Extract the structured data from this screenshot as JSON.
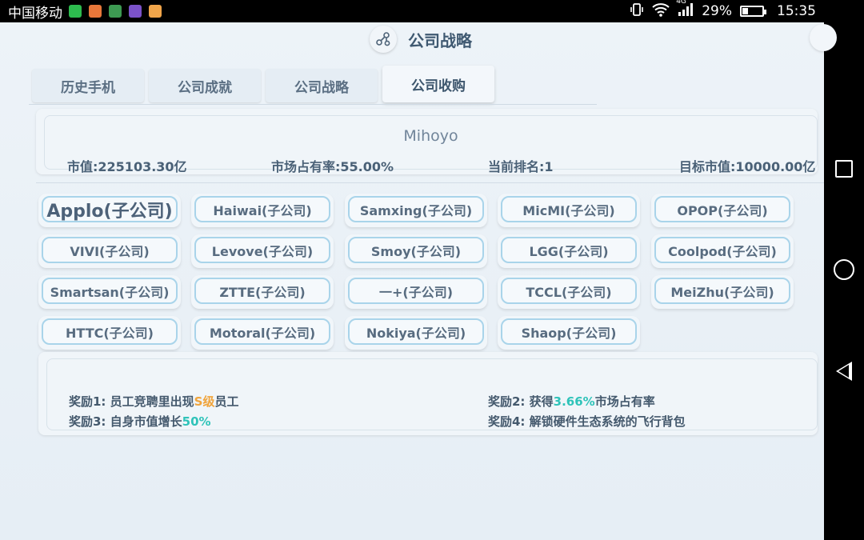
{
  "status_bar": {
    "carrier": "中国移动",
    "network": "4G",
    "battery": "29%",
    "time": "15:35",
    "app_icon_colors": [
      "#2dbb4e",
      "#e8773a",
      "#3d9a52",
      "#7b52c9",
      "#f0a54a"
    ]
  },
  "header": {
    "title": "公司战略",
    "icon": "share-network-icon"
  },
  "tabs": [
    {
      "label": "历史手机"
    },
    {
      "label": "公司成就"
    },
    {
      "label": "公司战略"
    },
    {
      "label": "公司收购",
      "active": true
    }
  ],
  "company": {
    "name": "Mihoyo",
    "stats": [
      {
        "label": "市值:",
        "value": "225103.30亿"
      },
      {
        "label": "市场占有率:",
        "value": "55.00%"
      },
      {
        "label": "当前排名:",
        "value": "1"
      },
      {
        "label": "目标市值:",
        "value": "10000.00亿"
      }
    ]
  },
  "subsidiaries": [
    {
      "label": "Applo(子公司)",
      "emphasis": true
    },
    {
      "label": "Haiwai(子公司)"
    },
    {
      "label": "Samxing(子公司)"
    },
    {
      "label": "MicMI(子公司)"
    },
    {
      "label": "OPOP(子公司)"
    },
    {
      "label": "VIVI(子公司)"
    },
    {
      "label": "Levove(子公司)"
    },
    {
      "label": "Smoy(子公司)"
    },
    {
      "label": "LGG(子公司)"
    },
    {
      "label": "Coolpod(子公司)"
    },
    {
      "label": "Smartsan(子公司)"
    },
    {
      "label": "ZTTE(子公司)"
    },
    {
      "label": "一+(子公司)"
    },
    {
      "label": "TCCL(子公司)"
    },
    {
      "label": "MeiZhu(子公司)"
    },
    {
      "label": "HTTC(子公司)"
    },
    {
      "label": "Motoral(子公司)"
    },
    {
      "label": "Nokiya(子公司)"
    },
    {
      "label": "Shaop(子公司)"
    }
  ],
  "rewards": [
    {
      "prefix": "奖励1: 员工竞聘里出现",
      "highlight": "S级",
      "suffix": "员工",
      "color": "#f0a43c"
    },
    {
      "prefix": "奖励2: 获得",
      "highlight": "3.66%",
      "suffix": "市场占有率",
      "color": "#2fc3b9"
    },
    {
      "prefix": "奖励3: 自身市值增长",
      "highlight": "50%",
      "suffix": "",
      "color": "#2fc3b9"
    },
    {
      "prefix": "奖励4: 解锁硬件生态系统的飞行背包",
      "highlight": "",
      "suffix": "",
      "color": ""
    }
  ]
}
